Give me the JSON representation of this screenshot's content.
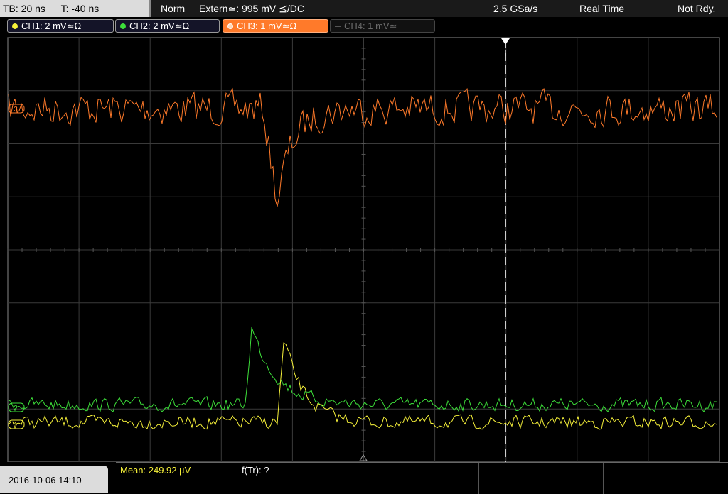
{
  "topbar": {
    "timebase": "TB: 20 ns",
    "trigger_offset": "T: -40 ns",
    "mode": "Norm",
    "trigger": "Extern≃: 995 mV ⪯/DC",
    "sample_rate": "2.5 GSa/s",
    "acquisition": "Real Time",
    "state": "Not Rdy."
  },
  "channels": [
    {
      "label": "CH1: 2 mV≃Ω",
      "color": "#f7f23a",
      "state": "on"
    },
    {
      "label": "CH2: 2 mV≃Ω",
      "color": "#3de03a",
      "state": "on"
    },
    {
      "label": "CH3: 1 mV≃Ω",
      "color": "#ff7a2a",
      "state": "active"
    },
    {
      "label": "CH4: 1 mV≃",
      "color": "#6a6a6a",
      "state": "off"
    }
  ],
  "markers": {
    "trigger": "T",
    "ch1": "1",
    "ch2": "2",
    "ch3": "3"
  },
  "bottombar": {
    "datetime": "2016-10-06 14:10",
    "mean": "Mean: 249.92 µV",
    "freq": "f(Tr): ?"
  },
  "colors": {
    "ch1": "#f7f23a",
    "ch2": "#3de03a",
    "ch3": "#ff7a2a",
    "grid": "#3a3a3a"
  }
}
